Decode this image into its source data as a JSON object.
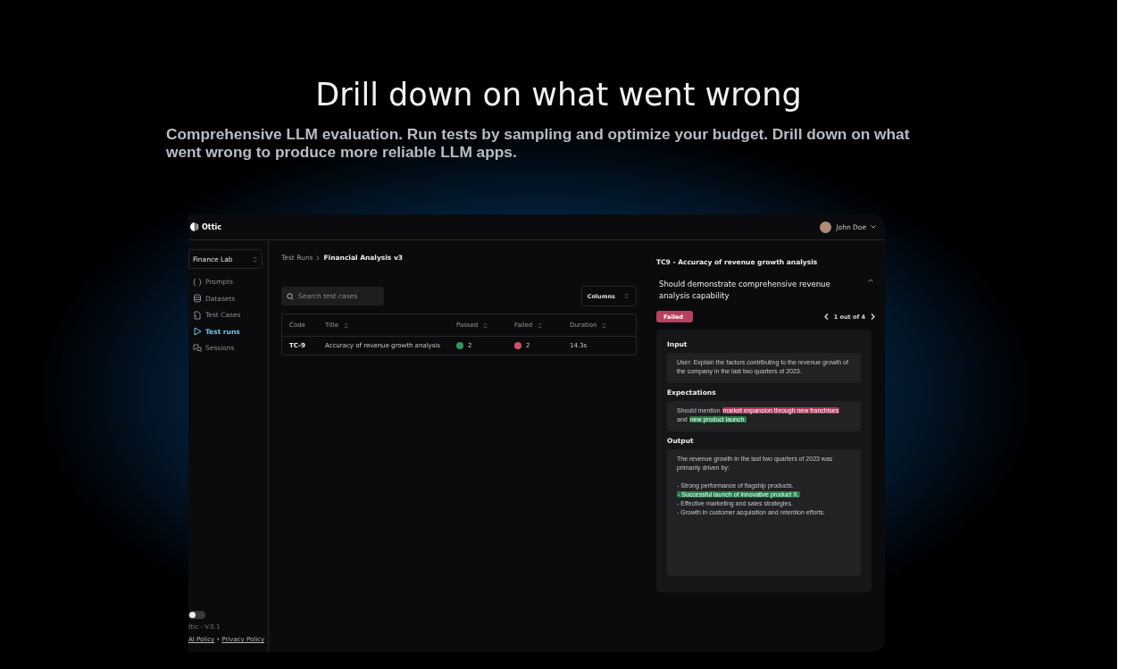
{
  "hero": {
    "title": "Drill down on what went wrong",
    "subtitle": "Comprehensive LLM evaluation. Run tests by sampling and optimize your budget. Drill down on what went wrong to produce more reliable LLM apps."
  },
  "app": {
    "logo": "Ottic",
    "user": {
      "name": "John Doe"
    },
    "sidebar": {
      "workspace": "Finance Lab",
      "items": [
        {
          "label": "Prompts",
          "selected": false
        },
        {
          "label": "Datasets",
          "selected": false
        },
        {
          "label": "Test Cases",
          "selected": false
        },
        {
          "label": "Test runs",
          "selected": true
        },
        {
          "label": "Sessions",
          "selected": false
        }
      ],
      "theme_toggle": {
        "on": false
      },
      "version": "ttic - V.0.1",
      "footer_links": [
        "AI Policy",
        "Privacy Policy"
      ],
      "footer_separator": "•"
    },
    "breadcrumb": [
      "Test Runs",
      "Financial Analysis v3"
    ],
    "search": {
      "placeholder": "Search test cases"
    },
    "columns_button": "Columns",
    "table": {
      "columns": [
        {
          "label": "Code",
          "sortable": false
        },
        {
          "label": "Title",
          "sortable": true
        },
        {
          "label": "Passed",
          "sortable": true
        },
        {
          "label": "Failed",
          "sortable": true
        },
        {
          "label": "Duration",
          "sortable": true
        }
      ],
      "rows": [
        {
          "code": "TC-9",
          "title": "Accuracy of revenue growth analysis",
          "passed": "2",
          "failed": "2",
          "duration": "14.3s"
        }
      ]
    },
    "detail": {
      "title": "TC9 - Accuracy of revenue growth analysis",
      "question": "Should demonstrate comprehensive revenue analysis capability",
      "expanded": true,
      "status": {
        "label": "Failed",
        "kind": "failed"
      },
      "pagination": "1 out of 4",
      "sections": [
        {
          "heading": "Input",
          "paragraphs": [
            [
              [
                {
                  "text": "User: Explain the factors contributing to the revenue growth of the company in the last two quarters of 2023.",
                  "kind": "plain"
                }
              ]
            ]
          ]
        },
        {
          "heading": "Expectations",
          "paragraphs": [
            [
              [
                {
                  "text": "Should mention ",
                  "kind": "plain"
                },
                {
                  "text": "market expansion through new franchises",
                  "kind": "fail"
                },
                {
                  "text": " and ",
                  "kind": "plain"
                },
                {
                  "text": "new product launch.",
                  "kind": "pass"
                }
              ]
            ]
          ]
        },
        {
          "heading": "Output",
          "paragraphs": [
            [
              [
                {
                  "text": "The revenue growth in the last two quarters of 2023 was primarily driven by:",
                  "kind": "plain"
                }
              ]
            ],
            [
              [
                {
                  "text": "- Strong performance of flagship products.",
                  "kind": "plain"
                }
              ],
              [
                {
                  "text": "- Successful launch of innovative product X.",
                  "kind": "pass"
                }
              ],
              [
                {
                  "text": "- Effective marketing and sales strategies.",
                  "kind": "plain"
                }
              ],
              [
                {
                  "text": "- Growth in customer acquisition and retention efforts.",
                  "kind": "plain"
                }
              ]
            ]
          ]
        }
      ]
    }
  }
}
